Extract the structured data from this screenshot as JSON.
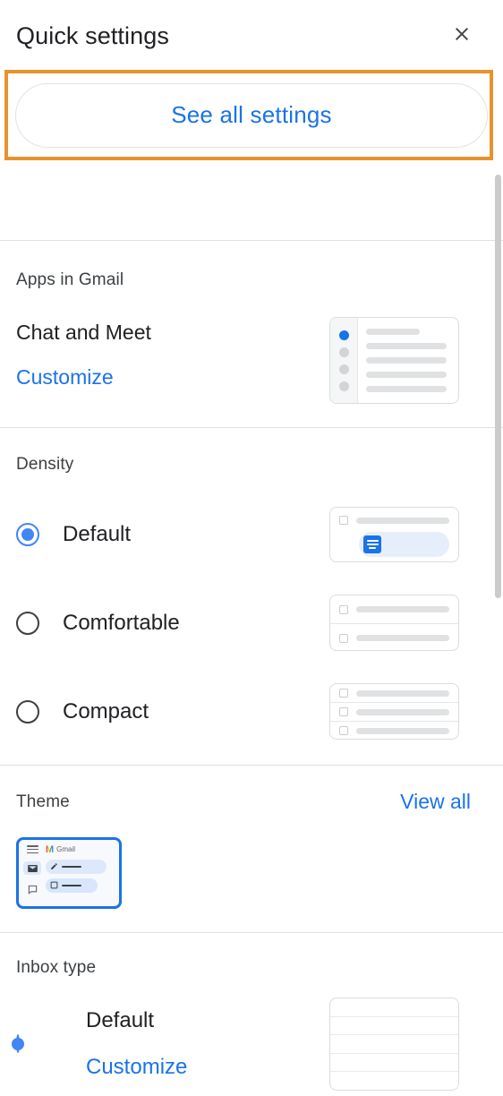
{
  "header": {
    "title": "Quick settings",
    "close_icon": "close-icon"
  },
  "see_all": {
    "label": "See all settings",
    "highlight_color": "#e8922e",
    "link_color": "#1a73e8"
  },
  "apps": {
    "section_title": "Apps in Gmail",
    "item_label": "Chat and Meet",
    "customize_label": "Customize"
  },
  "density": {
    "section_title": "Density",
    "options": [
      {
        "label": "Default",
        "selected": true
      },
      {
        "label": "Comfortable",
        "selected": false
      },
      {
        "label": "Compact",
        "selected": false
      }
    ]
  },
  "theme": {
    "section_title": "Theme",
    "view_all_label": "View all",
    "selected_theme": {
      "brand_letter": "M",
      "brand_name": "Gmail",
      "selected": true
    }
  },
  "inbox": {
    "section_title": "Inbox type",
    "option_label": "Default",
    "customize_label": "Customize",
    "selected": true
  },
  "scrollbar": {
    "orientation": "vertical",
    "thumb_color": "#c9cbcd"
  },
  "colors": {
    "accent_blue": "#1a73e8",
    "radio_blue": "#4285f4",
    "text_primary": "#202124",
    "text_secondary": "#3c4043",
    "divider": "#e0e0e0",
    "highlight_orange": "#e8922e"
  }
}
